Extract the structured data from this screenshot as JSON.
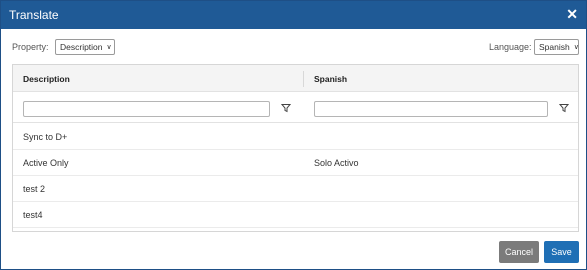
{
  "dialog": {
    "title": "Translate",
    "close_glyph": "✕"
  },
  "toolbar": {
    "property_label": "Property:",
    "property_value": "Description",
    "language_label": "Language:",
    "language_value": "Spanish"
  },
  "grid": {
    "columns": [
      "Description",
      "Spanish"
    ],
    "filters": {
      "description_value": "",
      "spanish_value": ""
    },
    "rows": [
      {
        "description": "Sync to D+",
        "spanish": ""
      },
      {
        "description": "Active Only",
        "spanish": "Solo Activo"
      },
      {
        "description": "test 2",
        "spanish": ""
      },
      {
        "description": "test4",
        "spanish": ""
      }
    ]
  },
  "footer": {
    "cancel_label": "Cancel",
    "save_label": "Save"
  },
  "icons": {
    "close": "close-icon",
    "dropdown": "chevron-down-icon",
    "filter": "filter-icon"
  },
  "colors": {
    "titlebar": "#1f5a96",
    "save_button": "#1f6fb5",
    "cancel_button": "#7b7b7b"
  }
}
